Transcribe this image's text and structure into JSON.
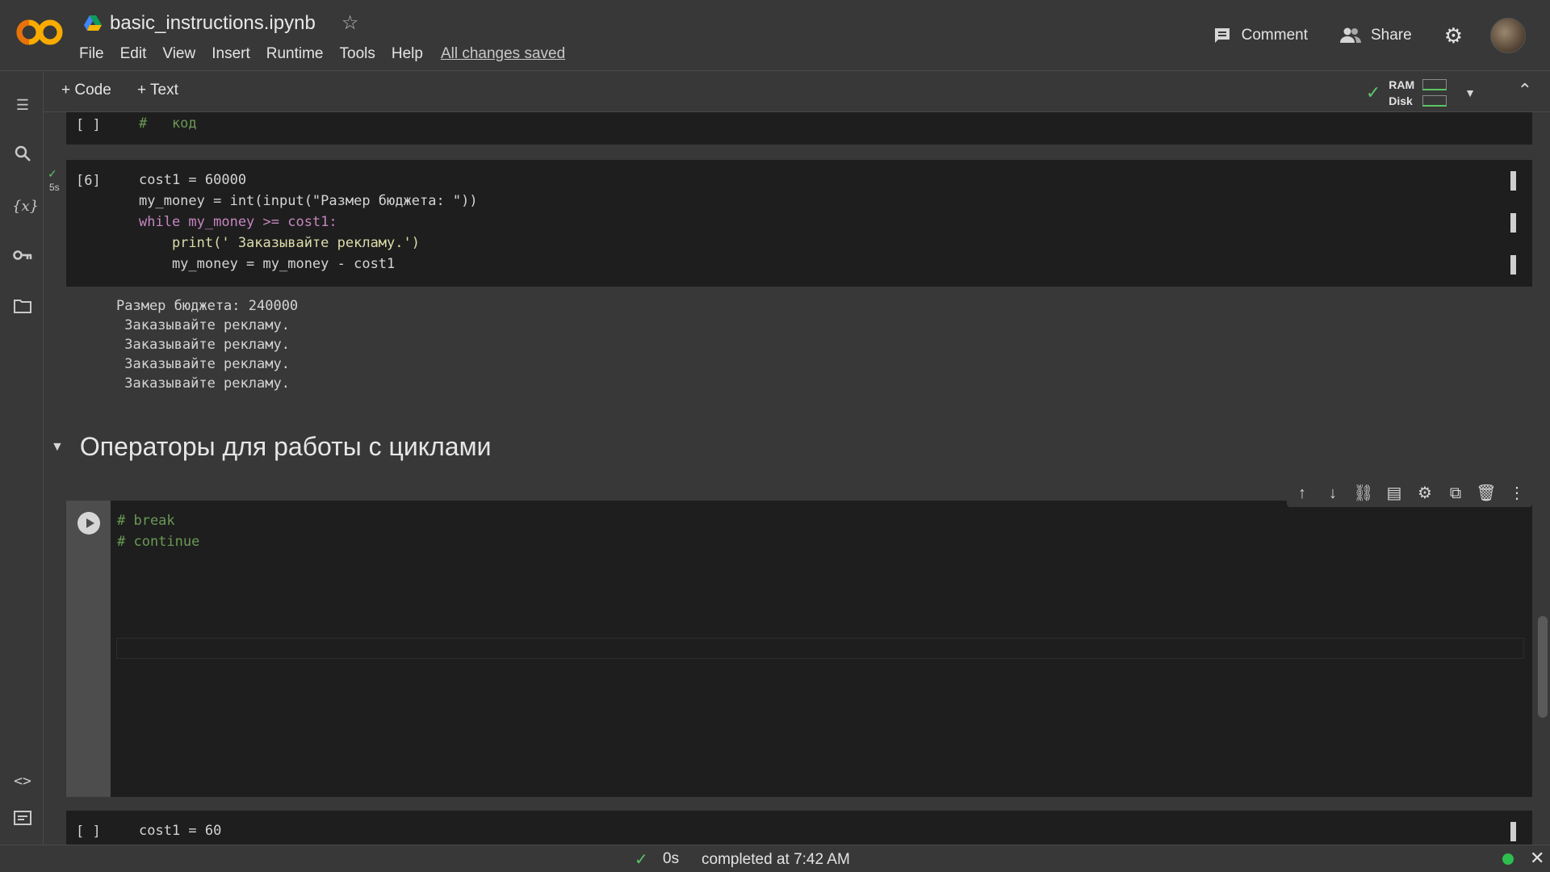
{
  "app": {
    "file_name": "basic_instructions.ipynb",
    "save_status": "All changes saved"
  },
  "menu": [
    "File",
    "Edit",
    "View",
    "Insert",
    "Runtime",
    "Tools",
    "Help"
  ],
  "header_actions": {
    "comment": "Comment",
    "share": "Share"
  },
  "toolbar": {
    "add_code": "+ Code",
    "add_text": "+ Text",
    "ram_label": "RAM",
    "disk_label": "Disk"
  },
  "cells": {
    "cell1": {
      "prompt": "[ ]",
      "code": "#   код"
    },
    "cell2": {
      "prompt": "[6]",
      "exec_time": "5s",
      "code_lines": [
        "cost1 = 60000",
        "my_money = int(input(\"Размер бюджета: \"))",
        "while my_money >= cost1:",
        "    print(' Заказывайте рекламу.')",
        "    my_money = my_money - cost1"
      ],
      "output_lines": [
        "Размер бюджета: 240000",
        " Заказывайте рекламу.",
        " Заказывайте рекламу.",
        " Заказывайте рекламу.",
        " Заказывайте рекламу."
      ]
    },
    "section_heading": "Операторы для работы с циклами",
    "cell3": {
      "code_lines": [
        "# break",
        "# continue"
      ]
    },
    "cell4": {
      "prompt": "[ ]",
      "code": "cost1 = 60"
    }
  },
  "status": {
    "duration": "0s",
    "message": "completed at 7:42 AM"
  },
  "colors": {
    "accent_green": "#5cc466",
    "logo_orange": "#f9ab00"
  }
}
